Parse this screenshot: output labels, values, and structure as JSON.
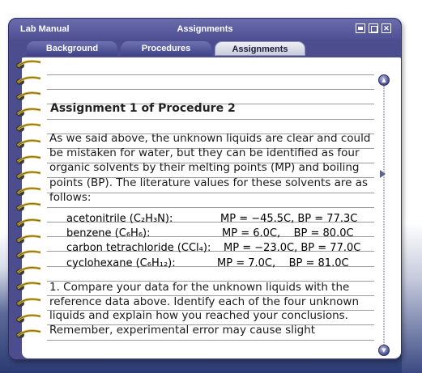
{
  "window": {
    "app_title": "Lab Manual",
    "section_title": "Assignments"
  },
  "tabs": [
    {
      "label": "Background",
      "active": false
    },
    {
      "label": "Procedures",
      "active": false
    },
    {
      "label": "Assignments",
      "active": true
    }
  ],
  "assignment": {
    "heading": "Assignment 1 of Procedure 2",
    "intro": "As we said above, the unknown liquids are clear and could be mistaken for water, but they can be identified as four organic solvents by their melting points (MP) and boiling points (BP). The literature values for these solvents are as follows:",
    "solvents": [
      {
        "name": "acetonitrile (C₂H₃N):",
        "props": "MP = −45.5C, BP = 77.3C"
      },
      {
        "name": "benzene (C₆H₆):",
        "props": "MP = 6.0C,    BP = 80.0C"
      },
      {
        "name": "carbon tetrachloride (CCl₄):",
        "props": "MP = −23.0C, BP = 77.0C"
      },
      {
        "name": "cyclohexane (C₆H₁₂):",
        "props": "MP = 7.0C,    BP = 81.0C"
      }
    ],
    "question_1": "1. Compare your data for the unknown liquids with the reference data above. Identify each of the four unknown liquids and explain how you reached your conclusions. Remember, experimental error may cause slight"
  },
  "colors": {
    "frame": "#4b4d8e",
    "tab_active": "#e2e4ee",
    "ruled_line": "#9c9c9c",
    "ring": "#d7b53a"
  },
  "icons": {
    "window_controls": [
      "minimize-icon",
      "maximize-icon",
      "close-icon"
    ],
    "scroll": [
      "scroll-up-icon",
      "scroll-down-icon"
    ],
    "binding": "spiral-ring-icon"
  }
}
